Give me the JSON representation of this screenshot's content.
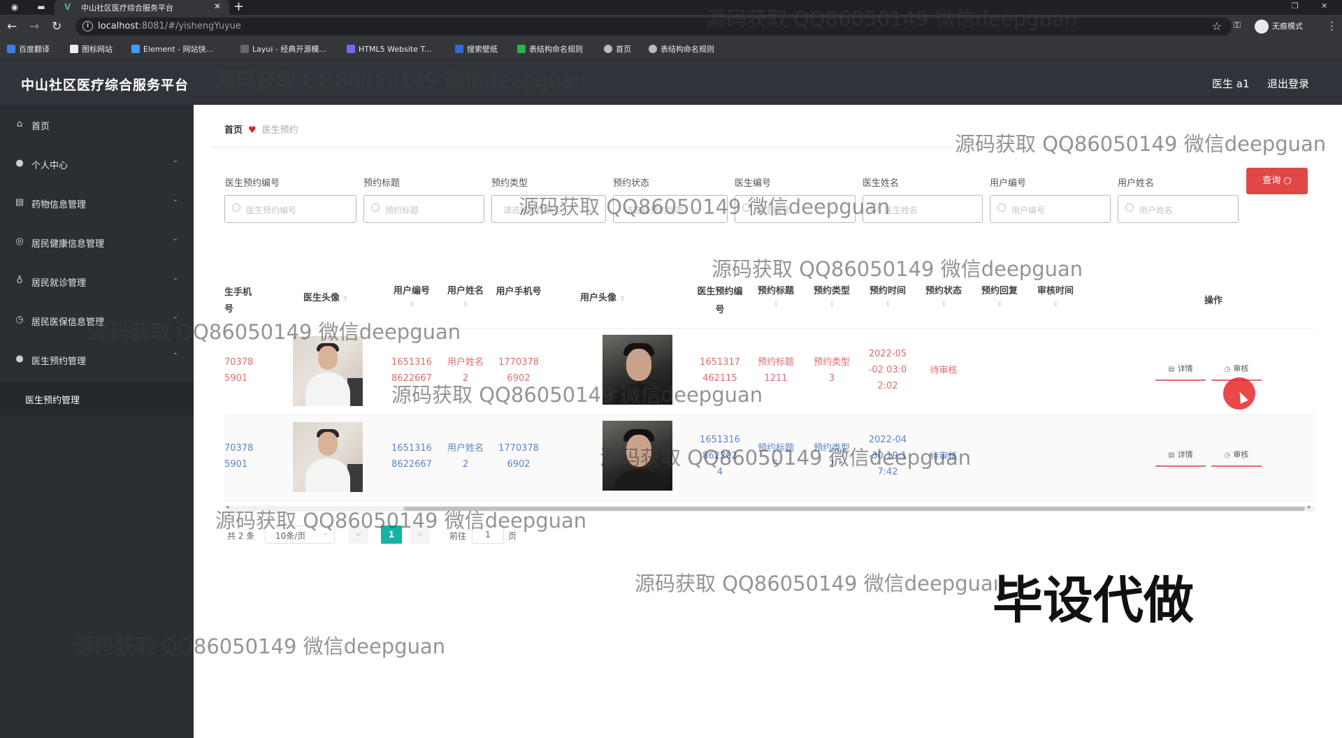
{
  "browser": {
    "tab_title": "中山社区医疗综合服务平台",
    "url_host": "localhost",
    "url_rest": ":8081/#/yishengYuyue",
    "incognito_label": "无痕模式",
    "bookmarks": [
      "百度翻译",
      "图标网站",
      "Element - 网站快...",
      "Layui - 经典开源模...",
      "HTML5 Website T...",
      "搜索壁纸",
      "表结构命名规则",
      "首页",
      "表结构命名规则"
    ]
  },
  "header": {
    "title": "中山社区医疗综合服务平台",
    "user": "医生 a1",
    "logout": "退出登录"
  },
  "sidebar": {
    "items": [
      {
        "label": "首页",
        "icon": "home-icon"
      },
      {
        "label": "个人中心",
        "icon": "user-icon"
      },
      {
        "label": "药物信息管理",
        "icon": "list-icon"
      },
      {
        "label": "居民健康信息管理",
        "icon": "health-icon"
      },
      {
        "label": "居民就诊管理",
        "icon": "mic-icon"
      },
      {
        "label": "居民医保信息管理",
        "icon": "shield-icon"
      },
      {
        "label": "医生预约管理",
        "icon": "user-icon"
      }
    ],
    "submenu": "医生预约管理"
  },
  "breadcrumb": {
    "home": "首页",
    "current": "医生预约"
  },
  "filters": [
    {
      "label": "医生预约编号",
      "placeholder": "医生预约编号"
    },
    {
      "label": "预约标题",
      "placeholder": "预约标题"
    },
    {
      "label": "预约类型",
      "placeholder": "请选择预约类型"
    },
    {
      "label": "预约状态",
      "placeholder": "请选择预约状态"
    },
    {
      "label": "医生编号",
      "placeholder": "医生编号"
    },
    {
      "label": "医生姓名",
      "placeholder": "医生姓名"
    },
    {
      "label": "用户编号",
      "placeholder": "用户编号"
    },
    {
      "label": "用户姓名",
      "placeholder": "用户姓名"
    }
  ],
  "query_button": "查询",
  "table": {
    "columns": {
      "doctor_phone": "生手机\n号",
      "doctor_avatar": "医生头像",
      "user_no": "用户编号",
      "user_name": "用户姓名",
      "user_phone": "用户手机号",
      "user_avatar": "用户头像",
      "appt_no": "医生预约编号",
      "appt_title": "预约标题",
      "appt_type": "预约类型",
      "appt_time": "预约时间",
      "appt_status": "预约状态",
      "appt_reply": "预约回复",
      "audit_time": "审核时间",
      "actions": "操作"
    },
    "rows": [
      {
        "doctor_phone": "70378\n5901",
        "user_no": "1651316\n8622667",
        "user_name": "用户姓名\n2",
        "user_phone": "1770378\n6902",
        "appt_no": "1651317\n462115",
        "appt_title": "预约标题\n1211",
        "appt_type": "预约类型\n3",
        "appt_time": "2022-05\n-02 03:0\n2:02",
        "appt_status": "待审核",
        "detail": "详情",
        "audit": "审核"
      },
      {
        "doctor_phone": "70378\n5901",
        "user_no": "1651316\n8622667",
        "user_name": "用户姓名\n2",
        "user_phone": "1770378\n6902",
        "appt_no": "1651316\n862202\n4",
        "appt_title": "预约标题\n5",
        "appt_type": "预约类型\n2",
        "appt_time": "2022-04\n-30 19:1\n7:42",
        "appt_status": "待审核",
        "detail": "详情",
        "audit": "审核"
      }
    ]
  },
  "pagination": {
    "total": "共 2 条",
    "page_size": "10条/页",
    "current_page": "1",
    "goto_label": "前往",
    "goto_value": "1",
    "unit": "页"
  },
  "watermark": "源码获取 QQ86050149 微信deepguan",
  "stamp": "毕设代做"
}
